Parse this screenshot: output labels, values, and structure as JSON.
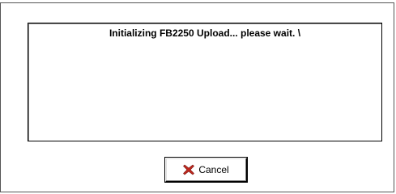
{
  "dialog": {
    "status_message": "Initializing FB2250 Upload... please wait. \\",
    "cancel_label": "Cancel",
    "cancel_icon": "red-x-icon"
  },
  "colors": {
    "cancel_icon": "#c0281e",
    "background": "#ffffff",
    "border": "#000000"
  }
}
